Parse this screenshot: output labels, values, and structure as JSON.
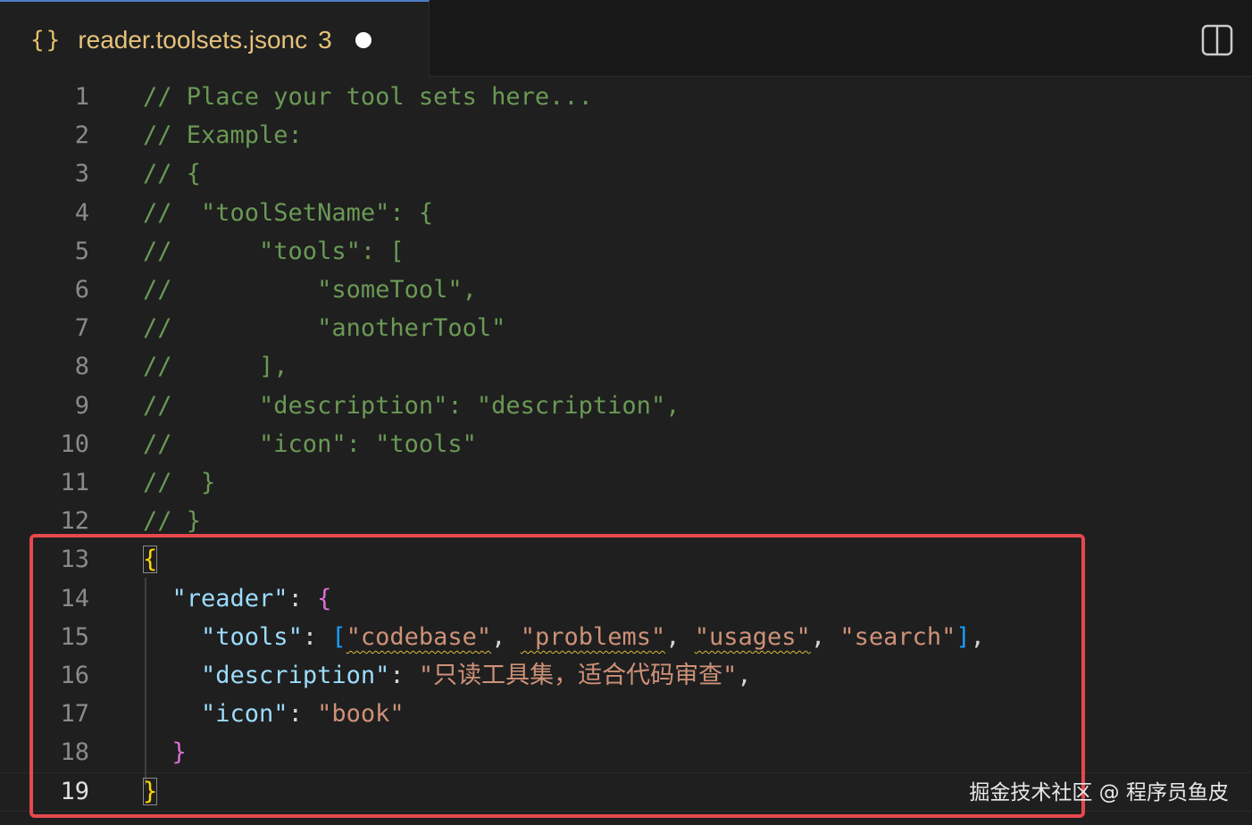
{
  "tab": {
    "icon": "json-braces-icon",
    "braces": "{}",
    "filename": "reader.toolsets.jsonc",
    "problem_count": "3",
    "dirty": true
  },
  "actions": {
    "split_editor_icon": "split-editor-icon"
  },
  "lines": [
    {
      "num": "1",
      "text": "// Place your tool sets here..."
    },
    {
      "num": "2",
      "text": "// Example:"
    },
    {
      "num": "3",
      "text": "// {"
    },
    {
      "num": "4",
      "text": "//  \"toolSetName\": {"
    },
    {
      "num": "5",
      "text": "//      \"tools\": ["
    },
    {
      "num": "6",
      "text": "//          \"someTool\","
    },
    {
      "num": "7",
      "text": "//          \"anotherTool\""
    },
    {
      "num": "8",
      "text": "//      ],"
    },
    {
      "num": "9",
      "text": "//      \"description\": \"description\","
    },
    {
      "num": "10",
      "text": "//      \"icon\": \"tools\""
    },
    {
      "num": "11",
      "text": "//  }"
    },
    {
      "num": "12",
      "text": "// }"
    },
    {
      "num": "13",
      "text": "{"
    },
    {
      "num": "14",
      "text": "  \"reader\": {"
    },
    {
      "num": "15",
      "text": "    \"tools\": [\"codebase\", \"problems\", \"usages\", \"search\"],"
    },
    {
      "num": "16",
      "text": "    \"description\": \"只读工具集，适合代码审查\","
    },
    {
      "num": "17",
      "text": "    \"icon\": \"book\""
    },
    {
      "num": "18",
      "text": "  }"
    },
    {
      "num": "19",
      "text": "}"
    }
  ],
  "tokens": {
    "l13_open": "{",
    "l14_key": "\"reader\"",
    "l14_colon": ": ",
    "l14_open": "{",
    "l15_key": "\"tools\"",
    "l15_colon": ": ",
    "l15_lbr": "[",
    "l15_s1": "\"codebase\"",
    "l15_c1": ", ",
    "l15_s2": "\"problems\"",
    "l15_c2": ", ",
    "l15_s3": "\"usages\"",
    "l15_c3": ", ",
    "l15_s4": "\"search\"",
    "l15_rbr": "]",
    "l15_end": ",",
    "l16_key": "\"description\"",
    "l16_colon": ": ",
    "l16_val": "\"只读工具集，适合代码审查\"",
    "l16_end": ",",
    "l17_key": "\"icon\"",
    "l17_colon": ": ",
    "l17_val": "\"book\"",
    "l18_close": "}",
    "l19_close": "}"
  },
  "active_line": "19",
  "highlight": {
    "color": "#e5484d"
  },
  "watermark": "掘金技术社区 @ 程序员鱼皮"
}
